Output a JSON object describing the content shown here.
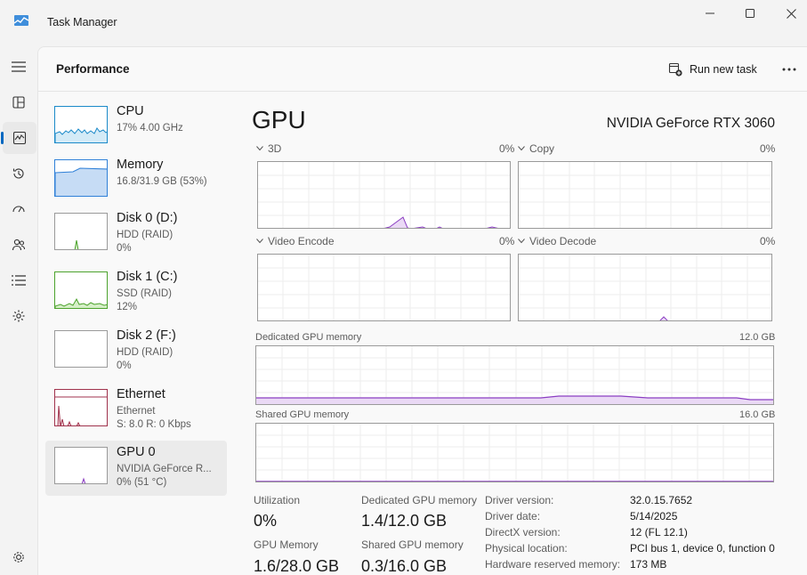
{
  "window": {
    "title": "Task Manager"
  },
  "header": {
    "title": "Performance",
    "run_new_task": "Run new task"
  },
  "devices": [
    {
      "name": "CPU",
      "line1": "17% 4.00 GHz",
      "line2": "",
      "graph_color": "#1b8ac9"
    },
    {
      "name": "Memory",
      "line1": "16.8/31.9 GB (53%)",
      "line2": "",
      "graph_color": "#2f80d8"
    },
    {
      "name": "Disk 0 (D:)",
      "line1": "HDD (RAID)",
      "line2": "0%",
      "graph_color": "#4ca32c"
    },
    {
      "name": "Disk 1 (C:)",
      "line1": "SSD (RAID)",
      "line2": "12%",
      "graph_color": "#4ca32c"
    },
    {
      "name": "Disk 2 (F:)",
      "line1": "HDD (RAID)",
      "line2": "0%",
      "graph_color": "#4ca32c"
    },
    {
      "name": "Ethernet",
      "line1": "Ethernet",
      "line2": "S: 8.0 R: 0 Kbps",
      "graph_color": "#a0324c"
    },
    {
      "name": "GPU 0",
      "line1": "NVIDIA GeForce R...",
      "line2": "0% (51 °C)",
      "graph_color": "#8b3ec2"
    }
  ],
  "gpu": {
    "title": "GPU",
    "model": "NVIDIA GeForce RTX 3060",
    "engines": [
      {
        "name": "3D",
        "value": "0%"
      },
      {
        "name": "Copy",
        "value": "0%"
      },
      {
        "name": "Video Encode",
        "value": "0%"
      },
      {
        "name": "Video Decode",
        "value": "0%"
      }
    ],
    "dedicated_memory": {
      "label": "Dedicated GPU memory",
      "max": "12.0 GB"
    },
    "shared_memory": {
      "label": "Shared GPU memory",
      "max": "16.0 GB"
    },
    "stats": {
      "utilization_label": "Utilization",
      "utilization": "0%",
      "dedicated_label": "Dedicated GPU memory",
      "dedicated": "1.4/12.0 GB",
      "gpu_memory_label": "GPU Memory",
      "gpu_memory": "1.6/28.0 GB",
      "shared_label": "Shared GPU memory",
      "shared": "0.3/16.0 GB"
    },
    "info": [
      {
        "key": "Driver version:",
        "value": "32.0.15.7652"
      },
      {
        "key": "Driver date:",
        "value": "5/14/2025"
      },
      {
        "key": "DirectX version:",
        "value": "12 (FL 12.1)"
      },
      {
        "key": "Physical location:",
        "value": "PCI bus 1, device 0, function 0"
      },
      {
        "key": "Hardware reserved memory:",
        "value": "173 MB"
      }
    ]
  },
  "colors": {
    "accent": "#0067c0",
    "gpu_line": "#8b3ec2",
    "gpu_fill": "#ead9f5"
  }
}
